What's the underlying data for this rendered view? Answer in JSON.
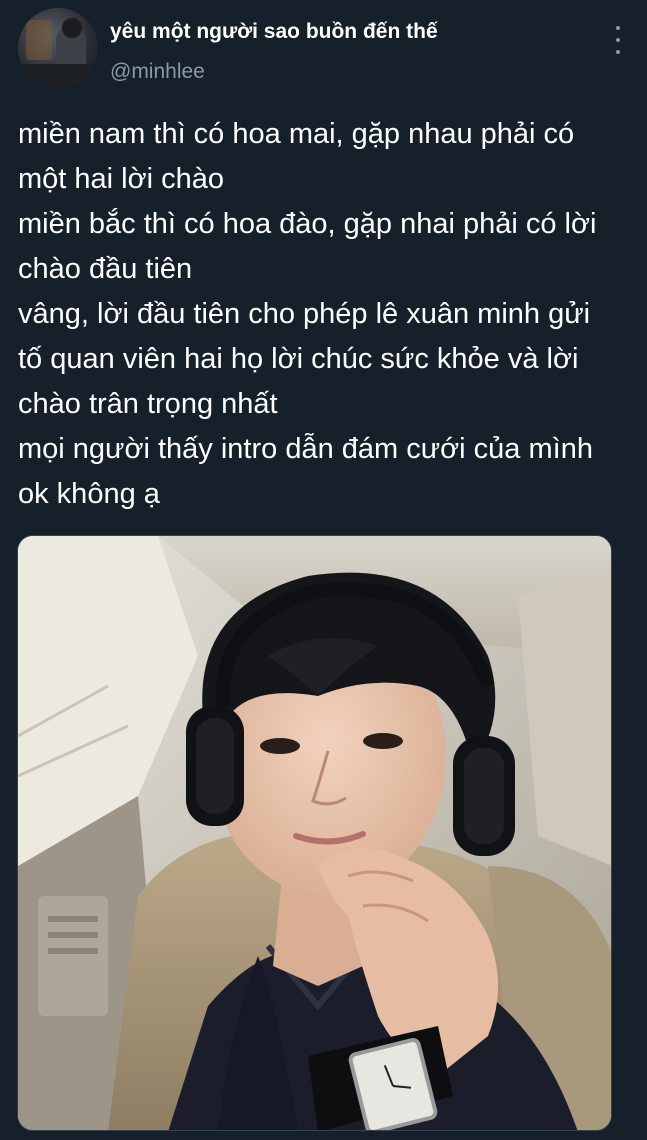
{
  "tweet": {
    "display_name": "yêu một người sao buồn đến thế",
    "handle": "@minhlee",
    "more_icon": "more-vertical-icon",
    "text_lines": [
      "miền nam thì có hoa mai, gặp nhau phải có",
      "một hai lời chào",
      "miền bắc thì có hoa đào, gặp nhai phải có lời",
      "chào đầu tiên",
      "vâng, lời đầu tiên cho phép lê xuân minh gửi",
      "tố quan viên hai họ lời chúc sức khỏe và lời",
      "chào trân trọng nhất",
      "mọi người thấy intro dẫn đám cưới của mình",
      "ok không ạ"
    ]
  },
  "colors": {
    "background": "#15202b",
    "text_primary": "#ffffff",
    "text_secondary": "#8b98a5",
    "border": "#38444d"
  }
}
